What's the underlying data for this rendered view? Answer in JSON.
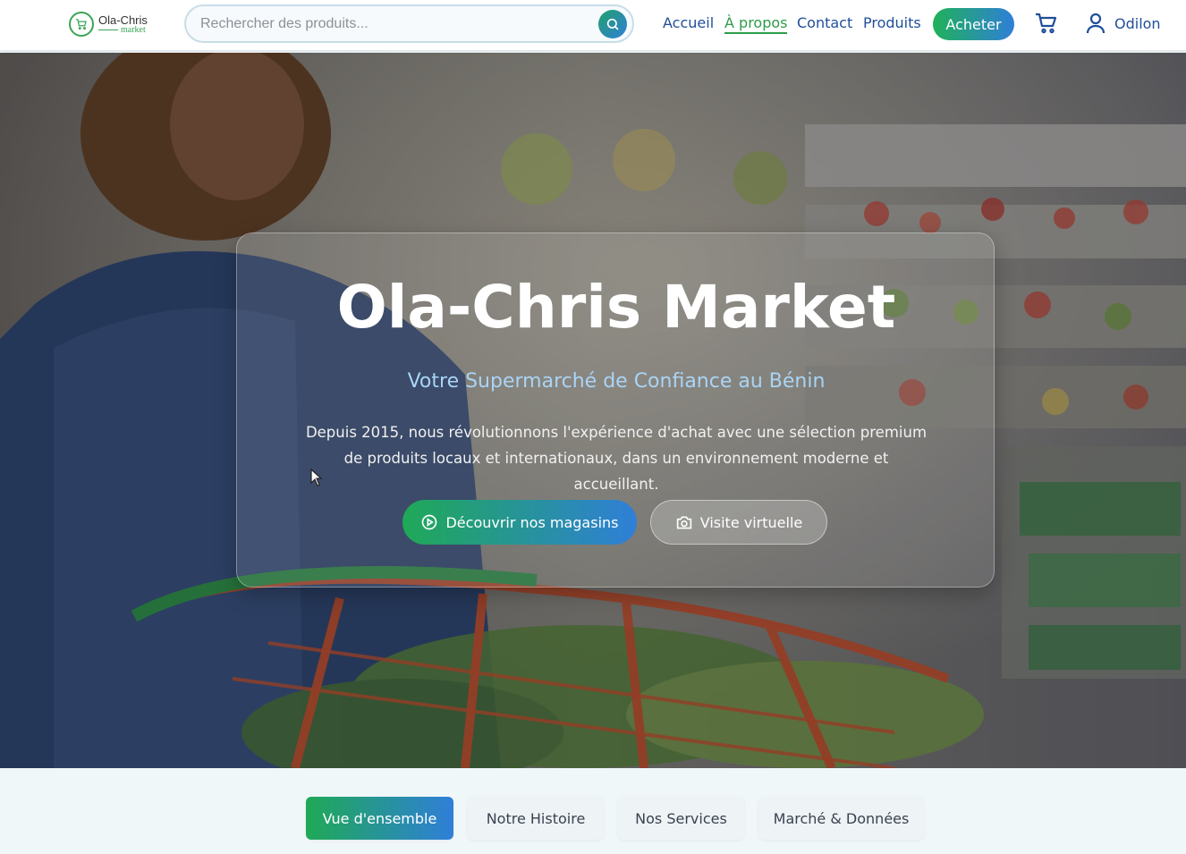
{
  "header": {
    "logo": {
      "name": "Ola-Chris",
      "sub": "market"
    },
    "search": {
      "placeholder": "Rechercher des produits...",
      "value": ""
    },
    "nav": [
      {
        "label": "Accueil",
        "active": false
      },
      {
        "label": "À propos",
        "active": true
      },
      {
        "label": "Contact",
        "active": false
      },
      {
        "label": "Produits",
        "active": false
      }
    ],
    "buy_label": "Acheter",
    "user_name": "Odilon"
  },
  "hero": {
    "title": "Ola-Chris Market",
    "subtitle": "Votre Supermarché de Confiance au Bénin",
    "description": "Depuis 2015, nous révolutionnons l'expérience d'achat avec une sélection premium de produits locaux et internationaux, dans un environnement moderne et accueillant.",
    "primary_button": "Découvrir nos magasins",
    "secondary_button": "Visite virtuelle"
  },
  "tabs": [
    {
      "label": "Vue d'ensemble",
      "active": true
    },
    {
      "label": "Notre Histoire",
      "active": false
    },
    {
      "label": "Nos Services",
      "active": false
    },
    {
      "label": "Marché & Données",
      "active": false
    }
  ],
  "colors": {
    "brand_green": "#2e9c4a",
    "brand_blue": "#1f4e9a",
    "accent_gradient_start": "#1fa956",
    "accent_gradient_end": "#2f7fd8"
  },
  "icons": {
    "logo": "cart-icon",
    "search": "search-icon",
    "cart": "shopping-cart-icon",
    "user": "user-icon",
    "primary_button": "play-circle-icon",
    "secondary_button": "camera-icon"
  }
}
